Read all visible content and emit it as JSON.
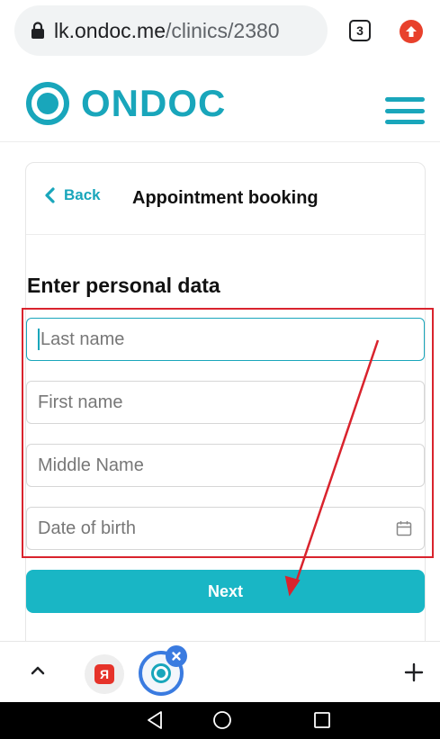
{
  "browser": {
    "url_domain": "lk.ondoc.me",
    "url_path": "/clinics/2380",
    "tab_count": "3"
  },
  "site": {
    "logo_text": "ONDOC",
    "brand_color": "#19a6bb"
  },
  "card": {
    "back_label": "Back",
    "title": "Appointment booking"
  },
  "form": {
    "section_title": "Enter personal data",
    "last_name_placeholder": "Last name",
    "first_name_placeholder": "First name",
    "middle_name_placeholder": "Middle Name",
    "date_of_birth_placeholder": "Date of birth",
    "next_label": "Next"
  },
  "bottom_bar": {
    "yandex_letter": "Я"
  },
  "annotation_color": "#d9232d",
  "icons": [
    "lock-icon",
    "menu-icon",
    "hamburger-icon",
    "chevron-left-icon",
    "calendar-icon",
    "chevron-up-icon",
    "plus-icon",
    "nav-back-icon",
    "nav-home-icon",
    "nav-recent-icon"
  ]
}
